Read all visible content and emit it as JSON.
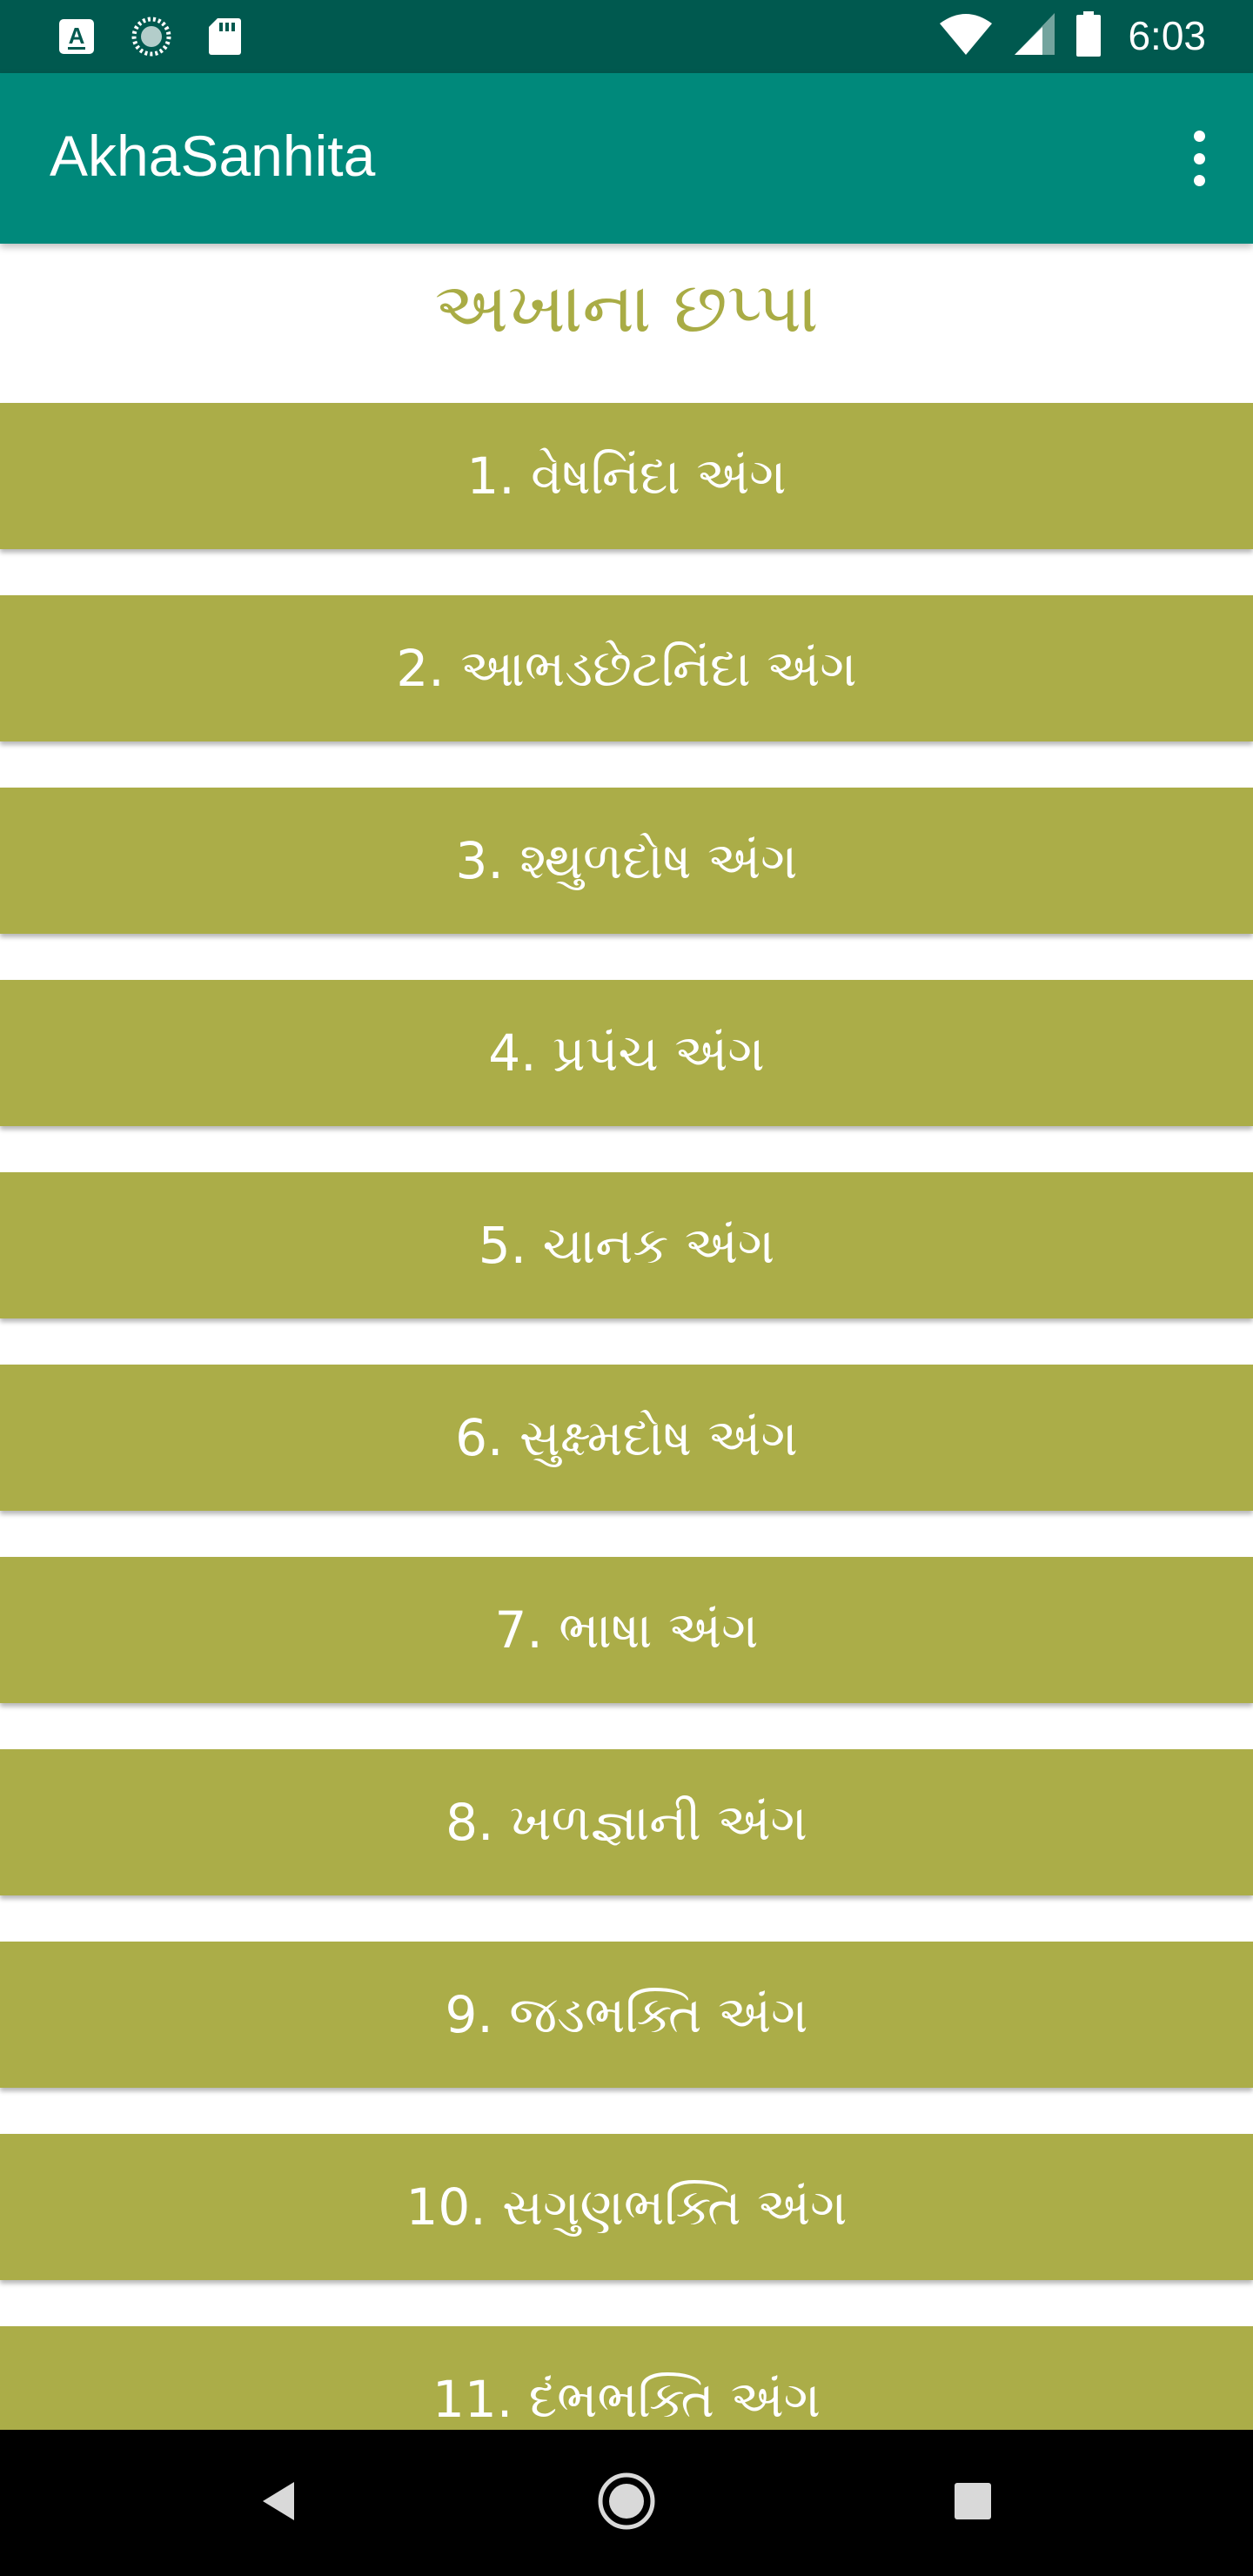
{
  "status_bar": {
    "time": "6:03",
    "left_icons": [
      "a-notification-icon",
      "loading-notification-icon",
      "sd-card-icon"
    ],
    "right_icons": [
      "wifi-icon",
      "cell-signal-icon",
      "battery-icon"
    ]
  },
  "app_bar": {
    "title": "AkhaSanhita",
    "menu_icon": "more-vert-icon"
  },
  "heading": "અખાના છપ્પા",
  "items": [
    {
      "label": "1. વેષનિંદા અંગ"
    },
    {
      "label": "2. આભડછેટનિંદા અંગ"
    },
    {
      "label": "3. શ્થુળદોષ અંગ"
    },
    {
      "label": "4. પ્રપંચ અંગ"
    },
    {
      "label": "5. ચાનક અંગ"
    },
    {
      "label": "6. સુક્ષ્મદોષ અંગ"
    },
    {
      "label": "7. ભાષા અંગ"
    },
    {
      "label": "8. ખળજ્ઞાની અંગ"
    },
    {
      "label": "9. જડભક્તિ અંગ"
    },
    {
      "label": "10. સગુણભક્તિ અંગ"
    },
    {
      "label": "11. દંભભક્તિ અંગ"
    }
  ],
  "nav_bar": {
    "back_icon": "back-icon",
    "home_icon": "home-icon",
    "recents_icon": "recents-icon"
  },
  "colors": {
    "status_bar": "#00594F",
    "app_bar": "#00897B",
    "accent_olive": "#ABAD48",
    "heading_text": "#A9AC45"
  }
}
